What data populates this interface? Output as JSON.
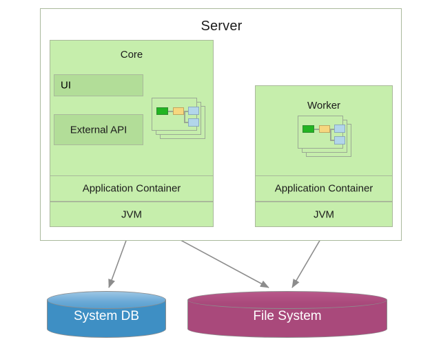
{
  "diagram": {
    "title": "Server",
    "server": {
      "label": "Server"
    },
    "core": {
      "title": "Core",
      "rows": [
        {
          "label": "UI"
        },
        {
          "label": "External API"
        },
        {
          "label": "Application Container"
        },
        {
          "label": "JVM"
        }
      ],
      "icon": "stacked-workflow-cards-icon"
    },
    "worker": {
      "title": "Worker",
      "rows": [
        {
          "label": "Application Container"
        },
        {
          "label": "JVM"
        }
      ],
      "icon": "stacked-workflow-cards-icon"
    },
    "storage": [
      {
        "label": "System DB",
        "shape": "cylinder",
        "color": "#3e8fc4"
      },
      {
        "label": "File System",
        "shape": "cylinder",
        "color": "#a9497b"
      }
    ],
    "connections": [
      {
        "from": "Core",
        "to": "Worker",
        "style": "double-arrow"
      },
      {
        "from": "Core JVM",
        "to": "System DB",
        "style": "double-arrow"
      },
      {
        "from": "Core JVM",
        "to": "File System",
        "style": "double-arrow"
      },
      {
        "from": "Worker JVM",
        "to": "File System",
        "style": "double-arrow"
      }
    ],
    "colors": {
      "panel_fill": "#c6eeac",
      "panel_fill_dark": "#b2dd98",
      "panel_border": "#a9b89b",
      "arrow": "#8c8c8c",
      "node_start": "#22b422",
      "node_middle": "#f6d77f",
      "node_end": "#b2d6ea"
    }
  }
}
